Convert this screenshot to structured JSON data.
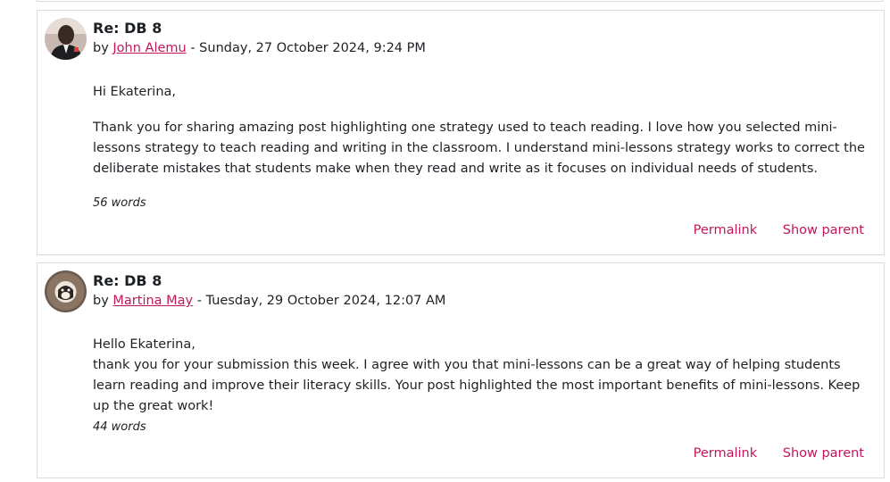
{
  "posts": [
    {
      "subject": "Re: DB 8",
      "by": "by",
      "author": "John Alemu",
      "date": "- Sunday, 27 October 2024, 9:24 PM",
      "greeting": "Hi Ekaterina,",
      "body": "Thank you for sharing amazing post highlighting one strategy used to teach reading. I love how you selected mini-lessons strategy to teach reading and writing in the classroom. I understand mini-lessons strategy works to correct the deliberate mistakes that students make when they read and write as it focuses on individual needs of students.",
      "word_count": "56 words",
      "permalink": "Permalink",
      "show_parent": "Show parent"
    },
    {
      "subject": "Re: DB 8",
      "by": "by",
      "author": "Martina May",
      "date": "- Tuesday, 29 October 2024, 12:07 AM",
      "greeting": "Hello Ekaterina,",
      "body": "thank you for your submission this week. I agree with you that mini-lessons can be a great way of helping students learn reading and improve their literacy skills. Your post highlighted the most important benefits of mini-lessons. Keep up the great work!",
      "word_count": "44 words",
      "permalink": "Permalink",
      "show_parent": "Show parent"
    }
  ],
  "colors": {
    "link": "#c2185b",
    "border": "#dcdcdc",
    "text": "#1d2125"
  }
}
